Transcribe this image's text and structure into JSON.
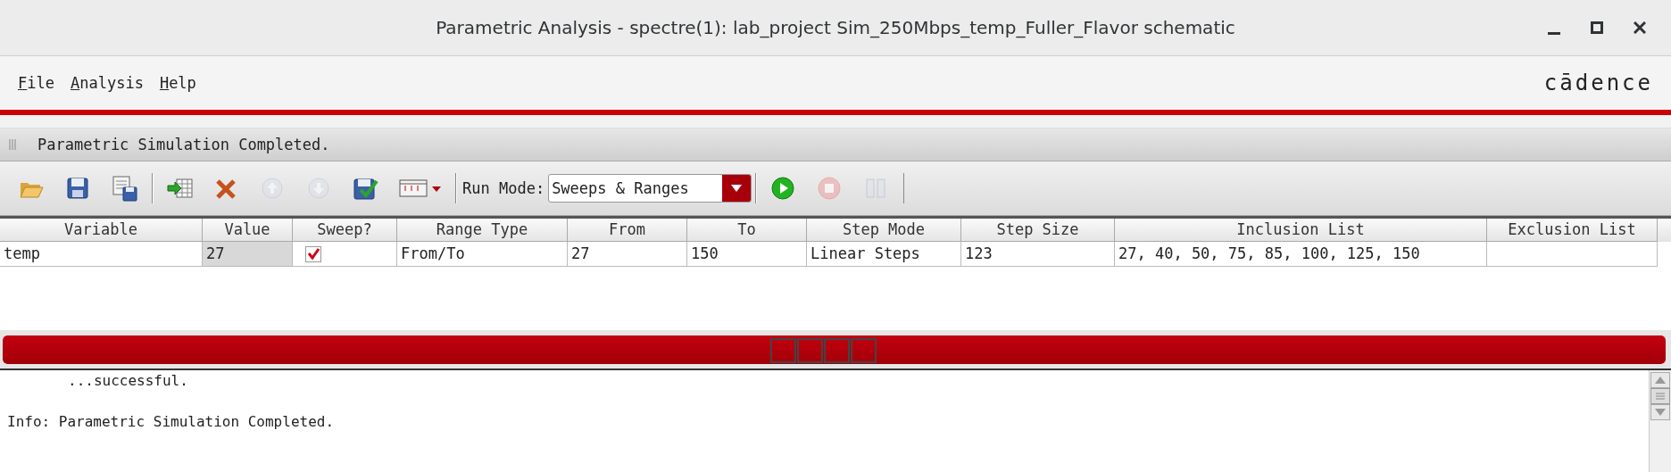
{
  "window": {
    "title": "Parametric Analysis - spectre(1): lab_project Sim_250Mbps_temp_Fuller_Flavor schematic"
  },
  "menu": [
    {
      "label": "File"
    },
    {
      "label": "Analysis"
    },
    {
      "label": "Help"
    }
  ],
  "brand": "cādence",
  "status": "Parametric Simulation Completed.",
  "toolbar": {
    "items": [
      {
        "kind": "open",
        "disabled": false
      },
      {
        "kind": "save",
        "disabled": false
      },
      {
        "kind": "save-as",
        "disabled": false
      },
      {
        "kind": "sep"
      },
      {
        "kind": "add",
        "disabled": false
      },
      {
        "kind": "delete",
        "disabled": false
      },
      {
        "kind": "up",
        "disabled": true
      },
      {
        "kind": "down",
        "disabled": true
      },
      {
        "kind": "check",
        "disabled": false
      },
      {
        "kind": "columns",
        "disabled": false
      },
      {
        "kind": "sep"
      },
      {
        "kind": "run",
        "disabled": false
      },
      {
        "kind": "stop",
        "disabled": true
      },
      {
        "kind": "pause",
        "disabled": true
      }
    ],
    "run_mode": {
      "label": "Run Mode:",
      "value": "Sweeps & Ranges"
    }
  },
  "table": {
    "columns": [
      "Variable",
      "Value",
      "Sweep?",
      "Range Type",
      "From",
      "To",
      "Step Mode",
      "Step Size",
      "Inclusion List",
      "Exclusion List"
    ],
    "rows": [
      {
        "cells": [
          {
            "kind": "text",
            "text": "temp"
          },
          {
            "kind": "readonly",
            "text": "27"
          },
          {
            "kind": "checkbox",
            "checked": true
          },
          {
            "kind": "text",
            "text": "From/To"
          },
          {
            "kind": "text",
            "text": "27"
          },
          {
            "kind": "text",
            "text": "150"
          },
          {
            "kind": "text",
            "text": "Linear Steps"
          },
          {
            "kind": "text",
            "text": "123"
          },
          {
            "kind": "text",
            "text": "27, 40, 50, 75, 85, 100, 125, 150"
          },
          {
            "kind": "empty"
          }
        ]
      }
    ]
  },
  "progress": {
    "level": 1
  },
  "log": [
    {
      "kind": "detail",
      "text": "...successful."
    },
    {
      "kind": "info",
      "text": "Info: Parametric Simulation Completed."
    }
  ]
}
